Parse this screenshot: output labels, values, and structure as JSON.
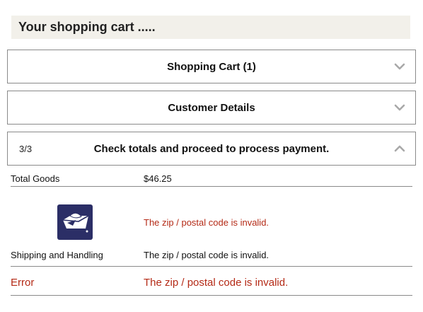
{
  "header": {
    "title": "Your shopping cart ....."
  },
  "panels": [
    {
      "title": "Shopping Cart (1)",
      "step": "",
      "icon": "chevron-down-icon"
    },
    {
      "title": "Customer Details",
      "step": "",
      "icon": "chevron-down-icon"
    },
    {
      "title": "Check totals and proceed to process payment.",
      "step": "3/3",
      "icon": "chevron-up-icon"
    }
  ],
  "totals": {
    "total_goods_label": "Total Goods",
    "total_goods_value": "$46.25",
    "carrier_icon": "usps-eagle-logo",
    "carrier_message": "The zip / postal code is invalid.",
    "shipping_label": "Shipping and Handling",
    "shipping_value": "The zip / postal code is invalid.",
    "error_label": "Error",
    "error_value": "The zip / postal code is invalid."
  },
  "colors": {
    "header_bg": "#f2f0ea",
    "border": "#8a8a8a",
    "error_red": "#b42a16",
    "usps_navy": "#2b2e66",
    "chevron": "#a9a9a9"
  }
}
